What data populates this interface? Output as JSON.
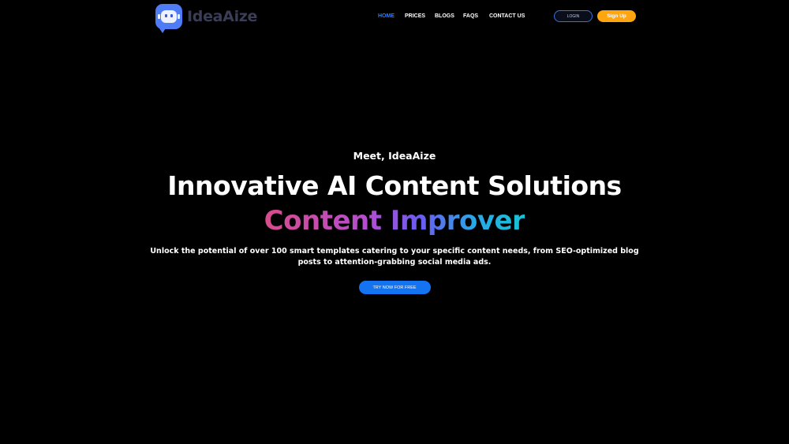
{
  "brand": {
    "name": "IdeaAize",
    "accent": "#4f7cf5"
  },
  "nav": {
    "items": [
      {
        "label": "HOME",
        "active": true
      },
      {
        "label": "PRICES",
        "active": false
      },
      {
        "label": "BLOGS",
        "active": false
      },
      {
        "label": "FAQS",
        "active": false
      },
      {
        "label": "CONTACT US",
        "active": false
      }
    ],
    "active_color": "#2f7cf6"
  },
  "auth": {
    "login_label": "LOGIN",
    "signup_label": "Sign Up",
    "signup_color": "#ffa50f"
  },
  "hero": {
    "eyebrow": "Meet, IdeaAize",
    "title": "Innovative AI Content Solutions",
    "rotator": "Content Improver",
    "description": "Unlock the potential of over 100 smart templates catering to your specific content needs, from SEO-optimized blog posts to attention-grabbing social media ads.",
    "cta_label": "TRY NOW FOR FREE",
    "cta_color": "#1473f0"
  },
  "icons": {
    "logo": "robot-chat-icon"
  }
}
